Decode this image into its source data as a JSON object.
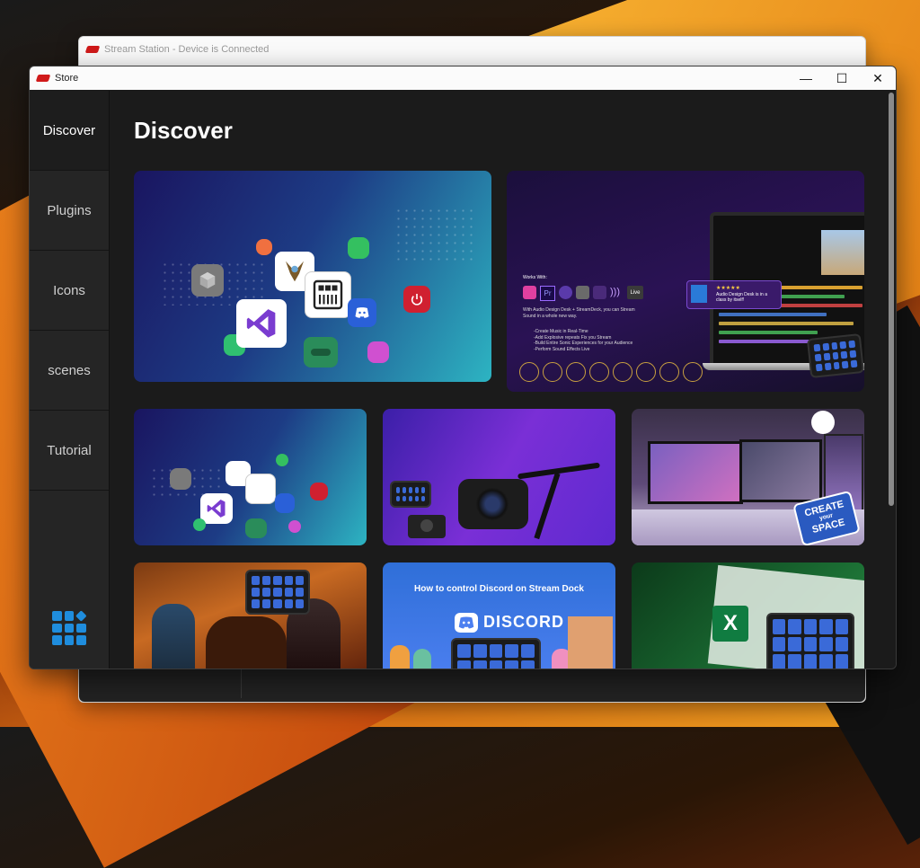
{
  "back_window": {
    "title": "Stream Station - Device is Connected"
  },
  "front_window": {
    "title": "Store"
  },
  "window_controls": {
    "minimize": "—",
    "maximize": "☐",
    "close": "✕"
  },
  "sidebar": {
    "items": [
      {
        "label": "Discover",
        "active": true
      },
      {
        "label": "Plugins"
      },
      {
        "label": "Icons"
      },
      {
        "label": "scenes"
      },
      {
        "label": "Tutorial"
      }
    ],
    "bottom_icon": "grid-icon"
  },
  "main": {
    "page_title": "Discover"
  },
  "cards": {
    "discord_tutorial": {
      "heading": "How to control Discord on Stream Dock",
      "brand": "DISCORD"
    },
    "setup": {
      "badge_line1": "CREATE",
      "badge_line2": "your",
      "badge_line3": "SPACE"
    },
    "audio": {
      "works_with": "Works With:",
      "body": "With Audio Design Desk + StreamDeck, you can Stream Sound in a whole new way.",
      "bullets": [
        "-Create Music in Real-Time",
        "-Add Explosive repeats Fix you Stream",
        "-Build Entire Sonic Experiences for your Audience",
        "-Perform Sound Effects Live"
      ],
      "review_stars": "★★★★★",
      "review_text": "Audio Design Desk is in a class by itself!",
      "live_label": "Live",
      "pr_label": "Pr"
    },
    "excel": {
      "letter": "X"
    }
  },
  "colors": {
    "accent": "#1f8ddd",
    "sidebar_bg": "#252525",
    "main_bg": "#1b1b1b"
  }
}
